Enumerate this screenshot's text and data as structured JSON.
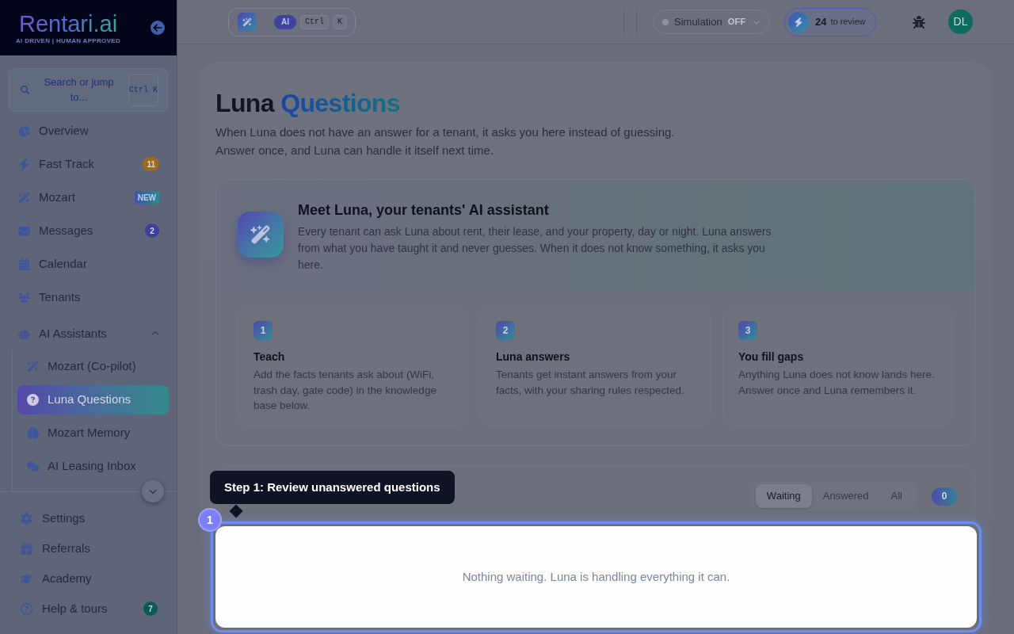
{
  "sidebar": {
    "logo": {
      "name": "Rentari.ai",
      "tagline": "AI DRIVEN | HUMAN APPROVED"
    },
    "search": {
      "placeholder": "Search or jump to...",
      "shortcut": "Ctrl K"
    },
    "items": [
      {
        "label": "Overview",
        "selected": false
      },
      {
        "label": "Fast Track",
        "selected": false,
        "badge": {
          "kind": "count",
          "text": "11",
          "color": "#a06a1c"
        }
      },
      {
        "label": "Mozart",
        "selected": false,
        "badge": {
          "kind": "tag",
          "text": "NEW"
        }
      },
      {
        "label": "Messages",
        "selected": false,
        "badge": {
          "kind": "count",
          "text": "2",
          "color": "#3c3f9e"
        }
      },
      {
        "label": "Calendar",
        "selected": false
      },
      {
        "label": "Tenants",
        "selected": false
      },
      {
        "label": "AI Assistants",
        "selected": false,
        "expanded": true,
        "children": [
          {
            "label": "Mozart (Co-pilot)",
            "selected": false
          },
          {
            "label": "Luna Questions",
            "selected": true
          },
          {
            "label": "Mozart Memory",
            "selected": false
          },
          {
            "label": "AI Leasing Inbox",
            "selected": false
          }
        ]
      }
    ],
    "bottom_items": [
      {
        "label": "Settings",
        "selected": false
      },
      {
        "label": "Referrals",
        "selected": false
      },
      {
        "label": "Academy",
        "selected": false
      },
      {
        "label": "Help & tours",
        "selected": false,
        "badge": {
          "kind": "count",
          "text": "7",
          "color": "#0b5a54"
        }
      }
    ]
  },
  "header": {
    "assistant_bar": {
      "tag": "AI",
      "keys": [
        "Ctrl",
        "K"
      ]
    },
    "simulation": {
      "label": "Simulation",
      "value": "OFF",
      "on": false
    },
    "review": {
      "count": "24",
      "label": "to review"
    },
    "user": {
      "initials": "DL"
    }
  },
  "page": {
    "title": "Luna",
    "title_accent": "Questions",
    "description": "When Luna does not have an answer for a tenant, it asks you here instead of guessing. Answer once, and Luna can handle it itself next time.",
    "intro": {
      "title": "Meet Luna, your tenants' AI assistant",
      "text": "Every tenant can ask Luna about rent, their lease, and your property, day or night. Luna answers from what you have taught it and never guesses. When it does not know something, it asks you here.",
      "steps": [
        {
          "number": "1",
          "title": "Teach",
          "text": "Add the facts tenants ask about (WiFi, trash day, gate code) in the knowledge base below."
        },
        {
          "number": "2",
          "title": "Luna answers",
          "text": "Tenants get instant answers from your facts, with your sharing rules respected."
        },
        {
          "number": "3",
          "title": "You fill gaps",
          "text": "Anything Luna does not know lands here. Answer once and Luna remembers it."
        }
      ]
    },
    "questions": {
      "tabs": [
        {
          "label": "Waiting",
          "selected": true
        },
        {
          "label": "Answered",
          "selected": false
        },
        {
          "label": "All",
          "selected": false
        }
      ],
      "count": "0",
      "empty_message": "Nothing waiting. Luna is handling everything it can."
    }
  },
  "tour": {
    "step": "1",
    "title": "Step 1: Review unanswered questions"
  }
}
